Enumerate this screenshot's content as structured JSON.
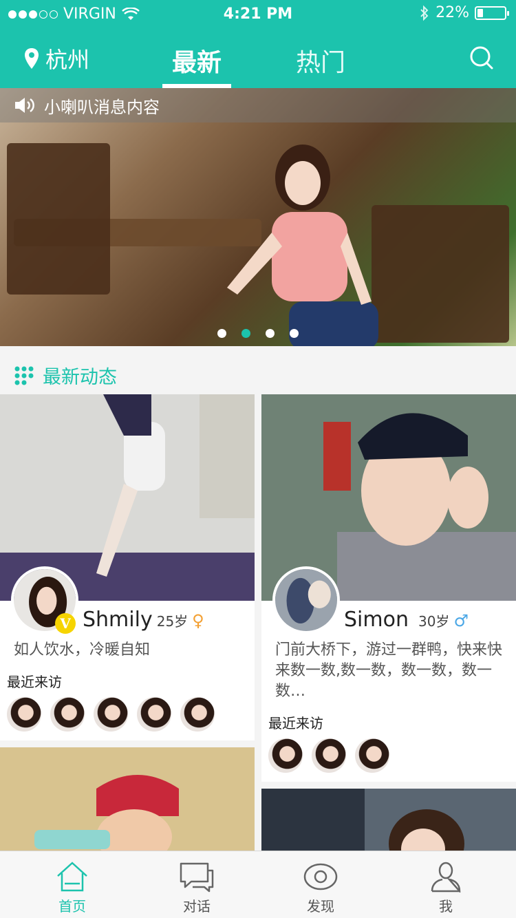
{
  "status": {
    "carrier": "VIRGIN",
    "time": "4:21 PM",
    "battery": "22%",
    "battery_level": 0.22
  },
  "nav": {
    "city": "杭州",
    "tabs": [
      "最新",
      "热门"
    ],
    "active_tab": "最新"
  },
  "banner": {
    "notice": "小喇叭消息内容",
    "pages": 4,
    "active_page": 2
  },
  "section": {
    "title": "最新动态"
  },
  "cards": [
    {
      "name": "Shmily",
      "age": "25岁",
      "gender": "♀",
      "verified": "V",
      "bio": "如人饮水，冷暖自知",
      "recent_label": "最近来访",
      "visitor_count": 5
    },
    {
      "name": "Simon",
      "age": "30岁",
      "gender": "♂",
      "bio": "门前大桥下，游过一群鸭，快来快来数一数,数一数，数一数，数一数…",
      "recent_label": "最近来访",
      "visitor_count": 3
    }
  ],
  "tabbar": {
    "items": [
      "首页",
      "对话",
      "发现",
      "我"
    ],
    "active": "首页"
  },
  "colors": {
    "accent": "#1cc3ad",
    "female": "#f3a033",
    "male": "#4aa7e6",
    "verified": "#f6d400"
  }
}
